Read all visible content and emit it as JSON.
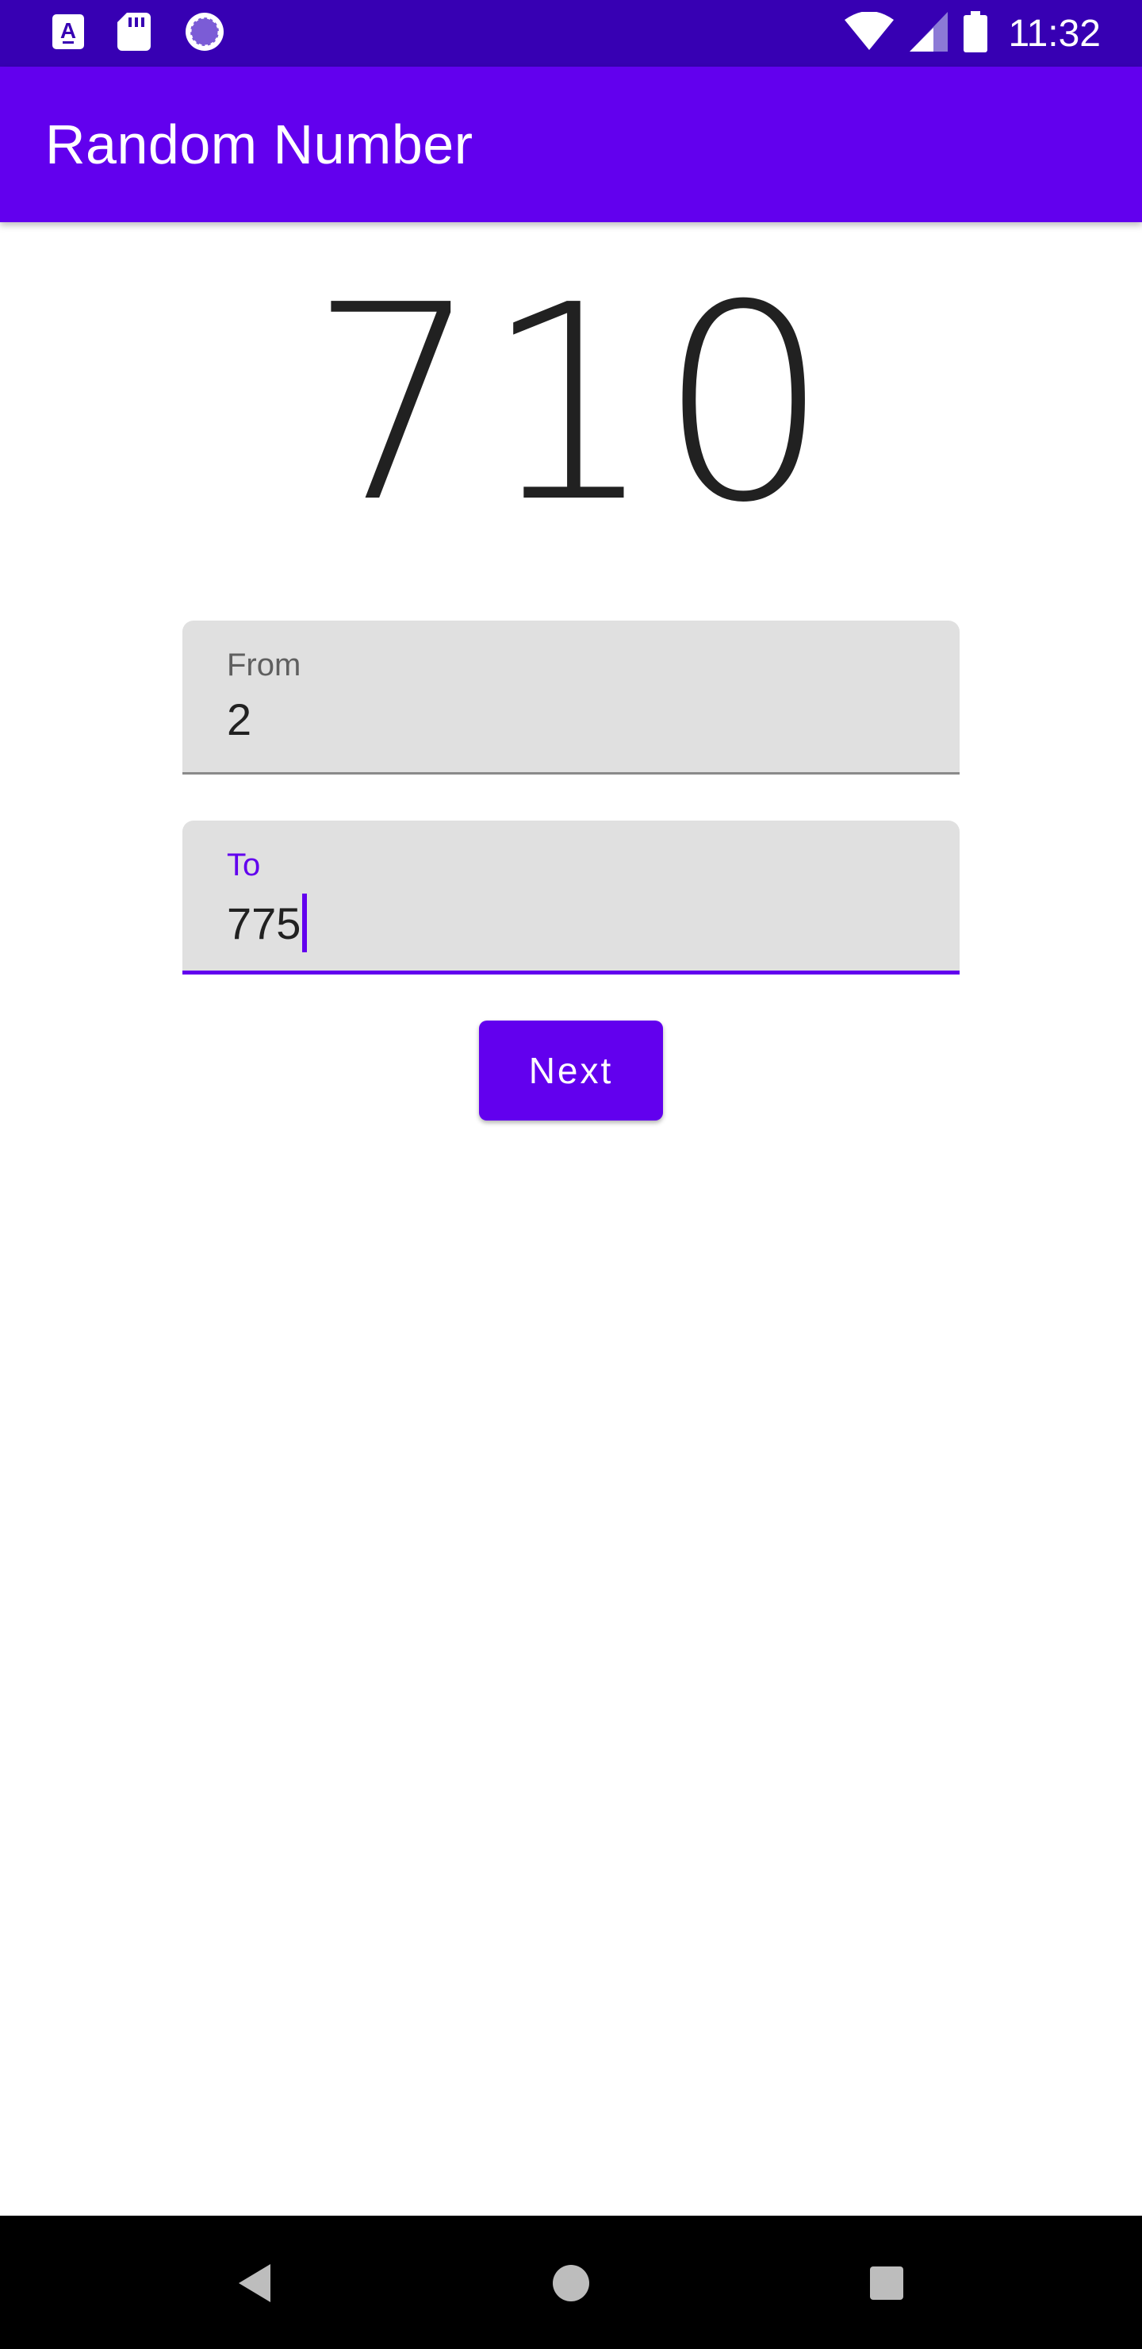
{
  "status_bar": {
    "time": "11:32",
    "icons": [
      "text-a-notification-icon",
      "sd-card-icon",
      "loading-circle-icon",
      "wifi-icon",
      "signal-icon",
      "battery-icon"
    ]
  },
  "app_bar": {
    "title": "Random Number"
  },
  "result": {
    "value": "710"
  },
  "form": {
    "from": {
      "label": "From",
      "value": "2"
    },
    "to": {
      "label": "To",
      "value": "775"
    }
  },
  "actions": {
    "next_label": "Next"
  },
  "nav_bar": {
    "icons": [
      "back-icon",
      "home-icon",
      "recents-icon"
    ]
  },
  "colors": {
    "status_bar": "#3700b3",
    "primary": "#6200ee",
    "field_background": "#e0e0e0",
    "text": "#212121"
  }
}
